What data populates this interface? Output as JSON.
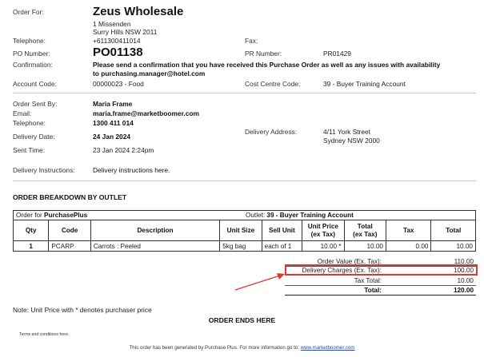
{
  "header": {
    "order_for_label": "Order For:",
    "supplier_name": "Zeus Wholesale",
    "address_line1": "1 Missenden",
    "address_line2": "Surry Hills NSW 2011",
    "telephone_label": "Telephone:",
    "telephone": "+611300411014",
    "fax_label": "Fax:",
    "po_label": "PO Number:",
    "po_number": "PO01138",
    "pr_label": "PR Number:",
    "pr_number": "PR01429",
    "confirmation_label": "Confirmation:",
    "confirmation_text_1": "Please send a confirmation that you have received this Purchase Order as well as any issues with availability",
    "confirmation_text_2": "to purchasing.manager@hotel.com",
    "account_code_label": "Account Code:",
    "account_code": "00000023 - Food",
    "cost_centre_label": "Cost Centre Code:",
    "cost_centre": "39 - Buyer Training Account"
  },
  "sender": {
    "sent_by_label": "Order Sent By:",
    "sent_by": "Maria Frame",
    "email_label": "Email:",
    "email": "maria.frame@marketboomer.com",
    "telephone_label": "Telephone:",
    "telephone": "1300 411 014",
    "delivery_date_label": "Delivery Date:",
    "delivery_date": "24 Jan 2024",
    "delivery_address_label": "Delivery Address:",
    "delivery_address_1": "4/11 York Street",
    "delivery_address_2": "Sydney NSW 2000",
    "sent_time_label": "Sent Time:",
    "sent_time": "23 Jan 2024 2:24pm",
    "instructions_label": "Delivery Instructions:",
    "instructions": "Delivery instructions here."
  },
  "breakdown": {
    "title": "ORDER BREAKDOWN BY OUTLET",
    "order_for_prefix": "Order for",
    "order_for_name": "PurchasePlus",
    "outlet_prefix": "Outlet:",
    "outlet_name": "39 - Buyer Training Account",
    "columns": {
      "qty": "Qty",
      "code": "Code",
      "description": "Description",
      "unit_size": "Unit Size",
      "sell_unit": "Sell Unit",
      "unit_price_1": "Unit Price",
      "unit_price_2": "(ex Tax)",
      "total_1": "Total",
      "total_2": "(ex Tax)",
      "tax": "Tax",
      "total": "Total"
    },
    "rows": [
      {
        "qty": "1",
        "code": "PCARP",
        "description": "Carrots : Peeled",
        "unit_size": "5kg bag",
        "sell_unit": "each of 1",
        "unit_price": "10.00 *",
        "total_ex": "10.00",
        "tax": "0.00",
        "total": "10.00"
      }
    ]
  },
  "totals": {
    "order_value_label": "Order Value (Ex. Tax):",
    "order_value": "110.00",
    "delivery_label": "Delivery Charges (Ex. Tax):",
    "delivery_value": "100.00",
    "tax_label": "Tax Total:",
    "tax_value": "10.00",
    "total_label": "Total:",
    "total_value": "120.00"
  },
  "footer": {
    "note": "Note: Unit Price with * denotes purchaser price",
    "order_ends": "ORDER ENDS HERE",
    "terms": "Terms and conditions here.",
    "generated_text": "This order has been generated by Purchase Plus. For more information go to:",
    "generated_link": "www.marketboomer.com"
  },
  "colors": {
    "highlight": "#d93a2b",
    "link": "#1a4fb4"
  }
}
